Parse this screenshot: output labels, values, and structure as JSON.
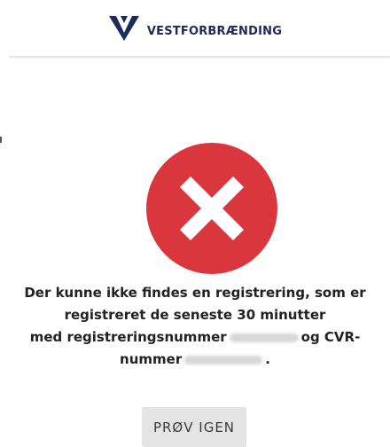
{
  "header": {
    "brand_name": "VESTFORBRÆNDING",
    "logo_icon": "vestforbraending-logo-icon",
    "brand_color": "#1d2a5b"
  },
  "status": {
    "icon": "error-x-icon",
    "icon_color": "#d9363e"
  },
  "message": {
    "line1": "Der kunne ikke findes en registrering, som er",
    "line2": "registreret de seneste 30 minutter",
    "line3_before": "med registreringsnummer",
    "line3_middle": "og CVR-",
    "line4_before": "nummer",
    "line4_after": "."
  },
  "actions": {
    "retry_label": "PRØV IGEN"
  }
}
